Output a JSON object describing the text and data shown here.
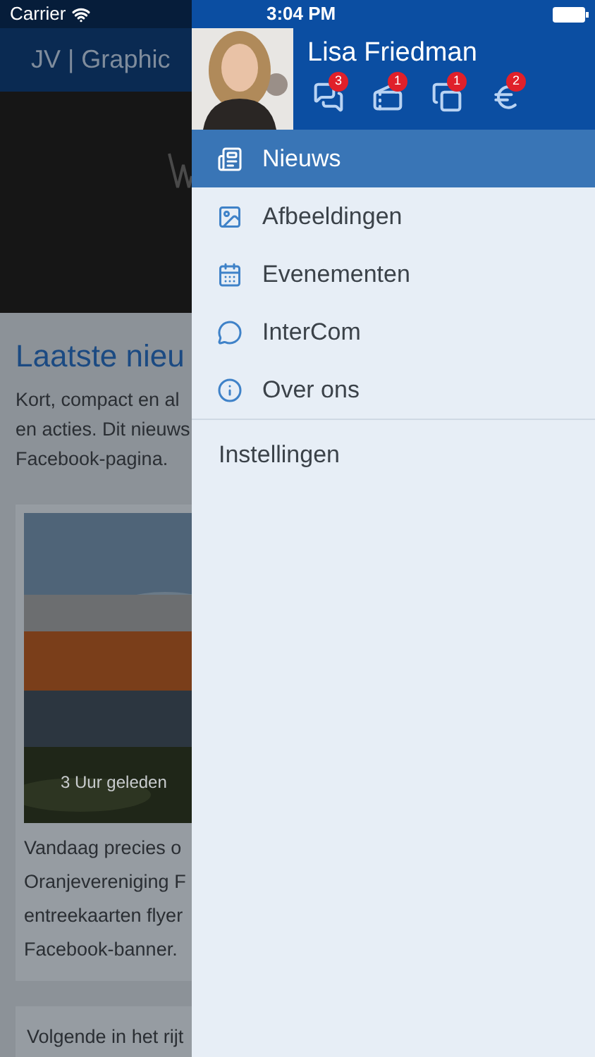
{
  "status_bar": {
    "carrier": "Carrier",
    "time": "3:04 PM"
  },
  "page": {
    "title": "JV | Graphic",
    "heading": "Laatste nieu",
    "intro": [
      "Kort, compact en al",
      "en acties. Dit nieuws",
      "Facebook-pagina."
    ],
    "post": {
      "time": "3 Uur geleden",
      "lines": [
        "Vandaag precies o",
        "Oranjevereniging F",
        "entreekaarten flyer",
        "Facebook-banner."
      ]
    },
    "next_post": "Volgende in het rijt"
  },
  "drawer": {
    "user": {
      "name": "Lisa Friedman"
    },
    "badges": [
      {
        "kind": "messages",
        "count": "3"
      },
      {
        "kind": "tickets",
        "count": "1"
      },
      {
        "kind": "documents",
        "count": "1"
      },
      {
        "kind": "payments",
        "count": "2"
      }
    ],
    "menu": [
      {
        "kind": "news",
        "label": "Nieuws",
        "selected": true
      },
      {
        "kind": "images",
        "label": "Afbeeldingen",
        "selected": false
      },
      {
        "kind": "events",
        "label": "Evenementen",
        "selected": false
      },
      {
        "kind": "chat",
        "label": "InterCom",
        "selected": false
      },
      {
        "kind": "info",
        "label": "Over ons",
        "selected": false
      }
    ],
    "settings": "Instellingen"
  }
}
